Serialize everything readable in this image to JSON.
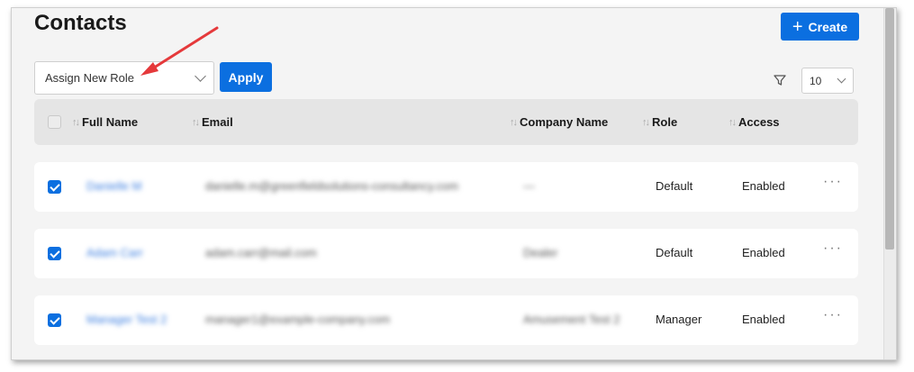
{
  "page": {
    "title": "Contacts",
    "create_label": "Create"
  },
  "toolbar": {
    "role_select_value": "Assign New Role",
    "apply_label": "Apply",
    "page_size": "10"
  },
  "table": {
    "columns": [
      "Full Name",
      "Email",
      "Company Name",
      "Role",
      "Access"
    ],
    "rows": [
      {
        "name": "Danielle M",
        "email": "danielle.m@greenfieldsolutions-consultancy.com",
        "company": "—",
        "role": "Default",
        "access": "Enabled",
        "checked": true
      },
      {
        "name": "Adam Carr",
        "email": "adam.carr@mail.com",
        "company": "Dealer",
        "role": "Default",
        "access": "Enabled",
        "checked": true
      },
      {
        "name": "Manager Test 2",
        "email": "manager1@example-company.com",
        "company": "Amusement Test 2",
        "role": "Manager",
        "access": "Enabled",
        "checked": true
      }
    ]
  },
  "icons": {
    "create": "plus-icon",
    "role_select": "chevron-down-icon",
    "filter": "filter-icon",
    "page_size": "chevron-down-icon",
    "sort": "sort-arrows-icon",
    "row_menu": "more-horizontal-icon"
  },
  "colors": {
    "primary": "#0b6fe0",
    "annotation_arrow": "#e5393b"
  }
}
